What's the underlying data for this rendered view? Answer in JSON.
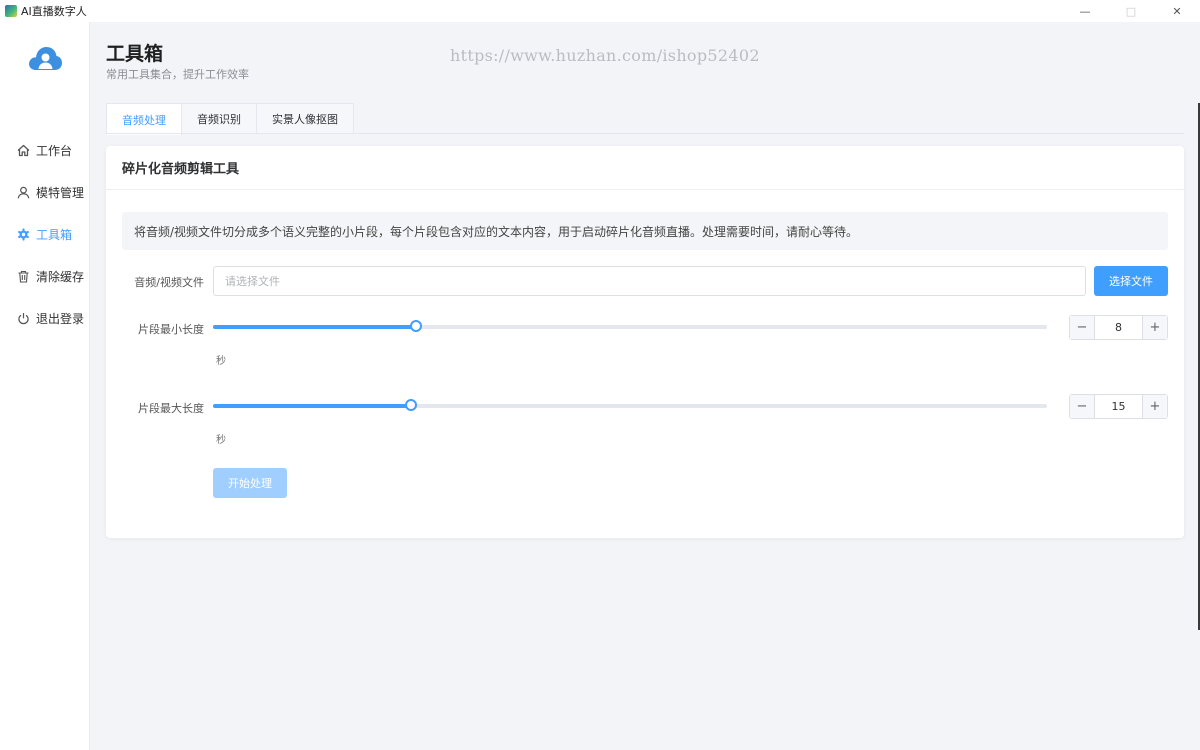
{
  "window": {
    "title": "AI直播数字人",
    "controls": {
      "minimize": "—",
      "maximize": "□",
      "close": "✕"
    }
  },
  "sidebar": {
    "logo_icon": "cloud-user-icon",
    "items": [
      {
        "label": "工作台",
        "icon": "home-icon",
        "active": false
      },
      {
        "label": "模特管理",
        "icon": "user-icon",
        "active": false
      },
      {
        "label": "工具箱",
        "icon": "gear-icon",
        "active": true
      },
      {
        "label": "清除缓存",
        "icon": "trash-icon",
        "active": false
      },
      {
        "label": "退出登录",
        "icon": "power-icon",
        "active": false
      }
    ]
  },
  "page": {
    "title": "工具箱",
    "subtitle": "常用工具集合，提升工作效率",
    "watermark": "https://www.huzhan.com/ishop52402"
  },
  "tabs": [
    {
      "label": "音频处理",
      "active": true
    },
    {
      "label": "音频识别",
      "active": false
    },
    {
      "label": "实景人像抠图",
      "active": false
    }
  ],
  "tool": {
    "title": "碎片化音频剪辑工具",
    "description": "将音频/视频文件切分成多个语义完整的小片段，每个片段包含对应的文本内容，用于启动碎片化音频直播。处理需要时间，请耐心等待。",
    "file": {
      "label": "音频/视频文件",
      "value": "",
      "placeholder": "请选择文件",
      "button": "选择文件"
    },
    "min_length": {
      "label": "片段最小长度",
      "value": "8",
      "fraction": 0.243,
      "unit": "秒",
      "minus": "−",
      "plus": "+"
    },
    "max_length": {
      "label": "片段最大长度",
      "value": "15",
      "fraction": 0.238,
      "unit": "秒",
      "minus": "−",
      "plus": "+"
    },
    "start_button": "开始处理"
  },
  "colors": {
    "accent": "#409eff",
    "accent_disabled": "#a0cfff",
    "background": "#f3f4f7"
  }
}
